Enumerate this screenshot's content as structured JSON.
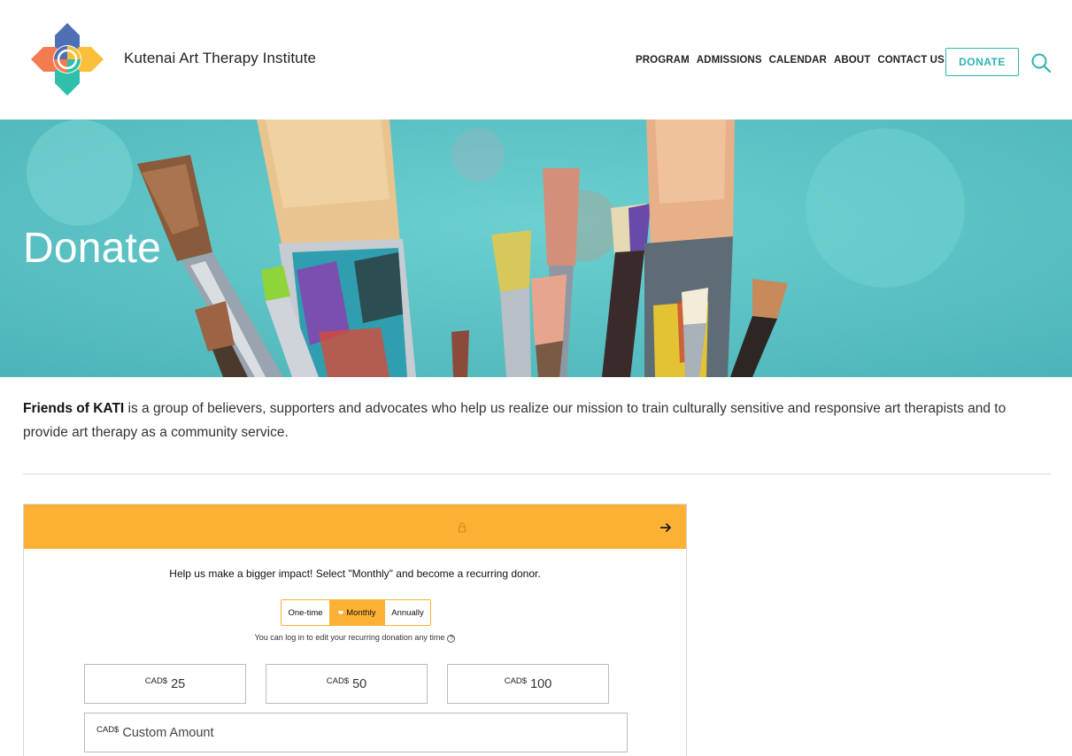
{
  "header": {
    "site_title": "Kutenai Art Therapy Institute",
    "nav": [
      "PROGRAM",
      "ADMISSIONS",
      "CALENDAR",
      "ABOUT",
      "CONTACT US"
    ],
    "donate_label": "DONATE",
    "search_icon": "search-icon",
    "accent_color": "#2fb3b0"
  },
  "hero": {
    "title": "Donate"
  },
  "intro": {
    "bold": "Friends of KATI",
    "text": " is a group of believers, supporters and advocates who help us realize our mission to train culturally sensitive and responsive art therapists and to provide art therapy as a community service."
  },
  "widget": {
    "bar_color": "#fcb134",
    "help_text": "Help us make a bigger impact! Select \"Monthly\" and become a recurring donor.",
    "frequency": {
      "options": [
        "One-time",
        "Monthly",
        "Annually"
      ],
      "selected": "Monthly"
    },
    "recurring_note": "You can log in to edit your recurring donation any time",
    "currency": "CAD$",
    "amounts": [
      "25",
      "50",
      "100"
    ],
    "custom_placeholder": "Custom Amount"
  }
}
